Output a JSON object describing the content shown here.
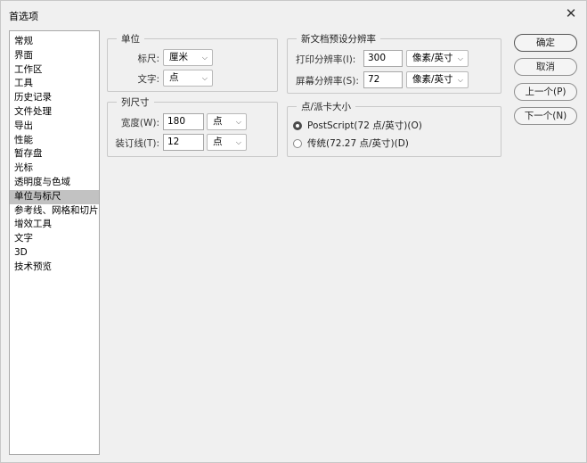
{
  "window": {
    "title": "首选项",
    "close": "✕"
  },
  "sidebar": {
    "items": [
      {
        "label": "常规"
      },
      {
        "label": "界面"
      },
      {
        "label": "工作区"
      },
      {
        "label": "工具"
      },
      {
        "label": "历史记录"
      },
      {
        "label": "文件处理"
      },
      {
        "label": "导出"
      },
      {
        "label": "性能"
      },
      {
        "label": "暂存盘"
      },
      {
        "label": "光标"
      },
      {
        "label": "透明度与色域"
      },
      {
        "label": "单位与标尺",
        "selected": true
      },
      {
        "label": "参考线、网格和切片"
      },
      {
        "label": "增效工具"
      },
      {
        "label": "文字"
      },
      {
        "label": "3D"
      },
      {
        "label": "技术预览"
      }
    ]
  },
  "units": {
    "title": "单位",
    "rulers_label": "标尺:",
    "rulers_value": "厘米",
    "type_label": "文字:",
    "type_value": "点"
  },
  "column_size": {
    "title": "列尺寸",
    "width_label": "宽度(W):",
    "width_value": "180",
    "width_unit": "点",
    "gutter_label": "装订线(T):",
    "gutter_value": "12",
    "gutter_unit": "点"
  },
  "new_doc_res": {
    "title": "新文档预设分辨率",
    "print_label": "打印分辨率(I):",
    "print_value": "300",
    "print_unit": "像素/英寸",
    "screen_label": "屏幕分辨率(S):",
    "screen_value": "72",
    "screen_unit": "像素/英寸"
  },
  "point_size": {
    "title": "点/派卡大小",
    "postscript_label": "PostScript(72 点/英寸)(O)",
    "traditional_label": "传统(72.27 点/英寸)(D)",
    "selected": "postscript"
  },
  "buttons": {
    "ok": "确定",
    "cancel": "取消",
    "prev": "上一个(P)",
    "next": "下一个(N)"
  },
  "icons": {
    "dropdown": "chevron-down-icon",
    "close": "close-icon"
  },
  "colors": {
    "selected_item": "#c2c2c2",
    "background": "#f0f0f0"
  }
}
